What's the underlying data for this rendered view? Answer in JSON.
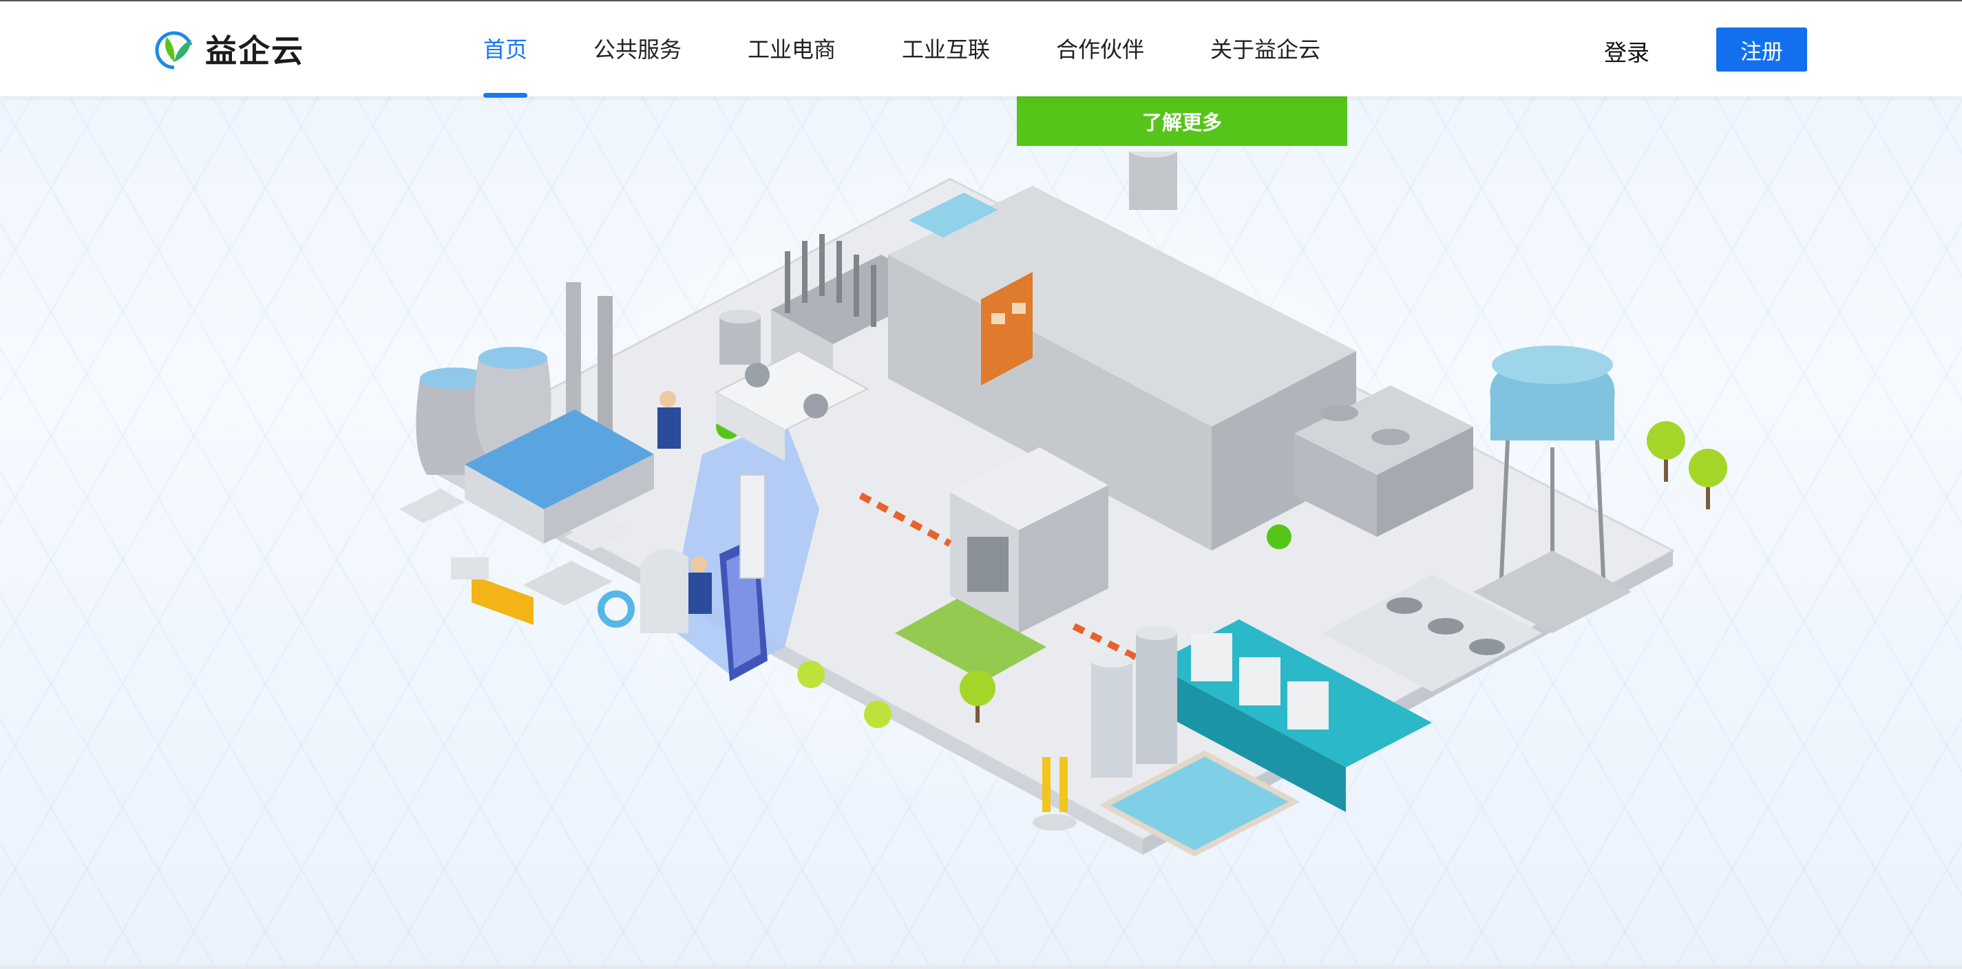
{
  "brand": {
    "name": "益企云"
  },
  "nav": {
    "items": [
      {
        "label": "首页",
        "active": true
      },
      {
        "label": "公共服务",
        "active": false
      },
      {
        "label": "工业电商",
        "active": false
      },
      {
        "label": "工业互联",
        "active": false
      },
      {
        "label": "合作伙伴",
        "active": false
      },
      {
        "label": "关于益企云",
        "active": false
      }
    ]
  },
  "auth": {
    "login_label": "登录",
    "register_label": "注册"
  },
  "hero": {
    "cta_label": "了解更多"
  },
  "colors": {
    "accent": "#1877f2",
    "cta_green": "#56c51a",
    "register_blue": "#1270ee"
  }
}
